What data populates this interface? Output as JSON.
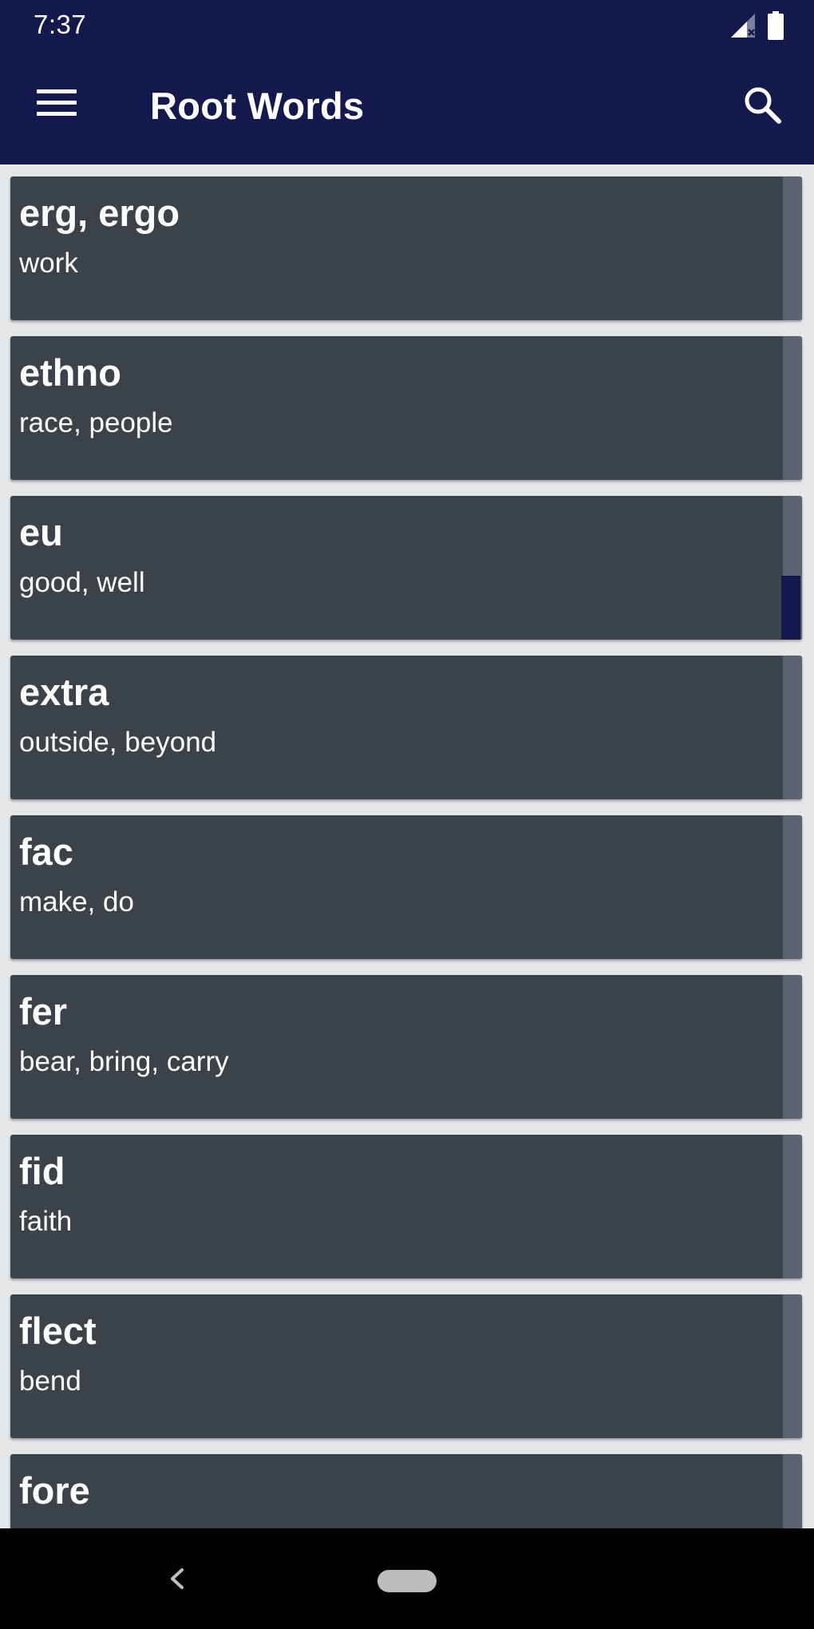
{
  "status_bar": {
    "time": "7:37",
    "icons": [
      "signal-no-data-icon",
      "battery-icon"
    ]
  },
  "app_bar": {
    "title": "Root Words",
    "icons": [
      "menu-icon",
      "search-icon"
    ]
  },
  "colors": {
    "primary": "#13194c",
    "card": "#3c424a",
    "card_strip": "#5b6270",
    "background": "#e6e7e9",
    "text": "#ffffff"
  },
  "roots": [
    {
      "root": "erg, ergo",
      "meaning": "work"
    },
    {
      "root": "ethno",
      "meaning": "race, people"
    },
    {
      "root": "eu",
      "meaning": "good, well"
    },
    {
      "root": "extra",
      "meaning": "outside, beyond"
    },
    {
      "root": "fac",
      "meaning": "make, do"
    },
    {
      "root": "fer",
      "meaning": "bear, bring, carry"
    },
    {
      "root": "fid",
      "meaning": "faith"
    },
    {
      "root": "flect",
      "meaning": "bend"
    },
    {
      "root": "fore",
      "meaning": ""
    }
  ],
  "nav_bar": {
    "icons": [
      "back-icon",
      "home-pill-icon"
    ]
  }
}
